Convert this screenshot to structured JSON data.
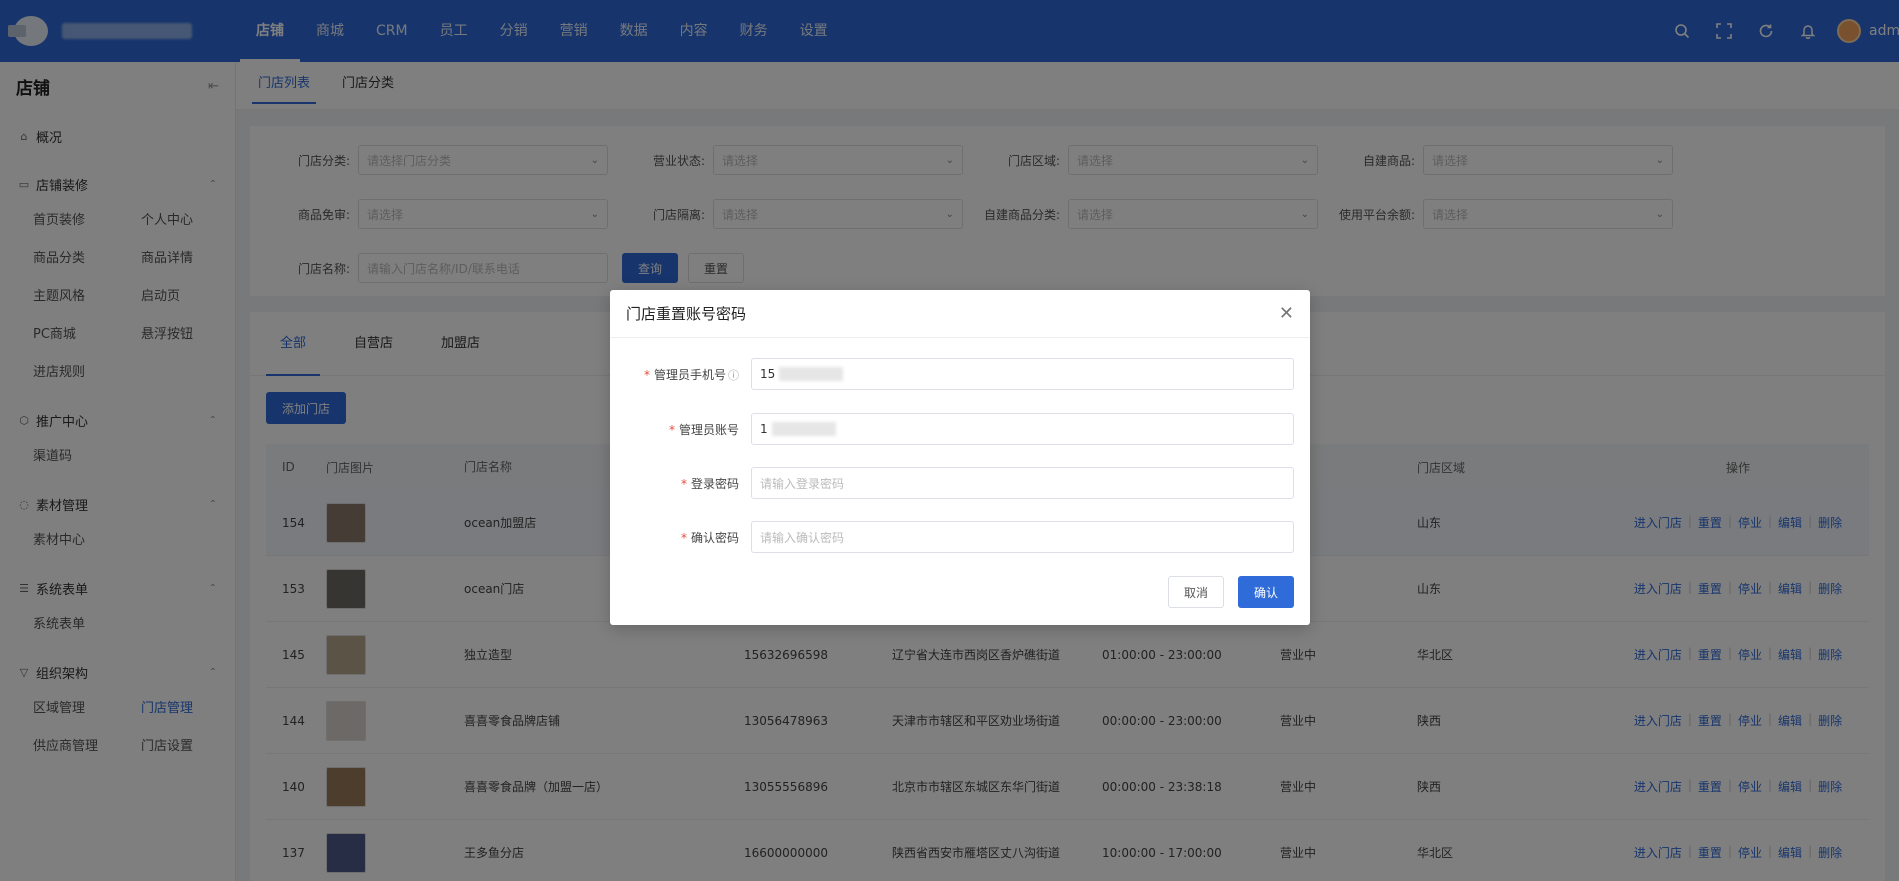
{
  "top_nav": {
    "items": [
      "店铺",
      "商城",
      "CRM",
      "员工",
      "分销",
      "营销",
      "数据",
      "内容",
      "财务",
      "设置"
    ],
    "active_index": 0,
    "user_name": "admin"
  },
  "icons": {
    "search": "search-icon",
    "fullscreen": "fullscreen-icon",
    "refresh": "refresh-icon",
    "bell": "bell-icon"
  },
  "sidebar": {
    "title": "店铺",
    "overview": "概况",
    "groups": [
      {
        "label": "店铺装修",
        "items": [
          "首页装修",
          "个人中心",
          "商品分类",
          "商品详情",
          "主题风格",
          "启动页",
          "PC商城",
          "悬浮按钮",
          "进店规则"
        ]
      },
      {
        "label": "推广中心",
        "items": [
          "渠道码"
        ]
      },
      {
        "label": "素材管理",
        "items": [
          "素材中心"
        ]
      },
      {
        "label": "系统表单",
        "items": [
          "系统表单"
        ]
      },
      {
        "label": "组织架构",
        "items": [
          "区域管理",
          "门店管理",
          "供应商管理",
          "门店设置"
        ]
      }
    ],
    "active_item": "门店管理"
  },
  "page_tabs": [
    "门店列表",
    "门店分类"
  ],
  "filters": {
    "store_category": {
      "label": "门店分类:",
      "placeholder": "请选择门店分类"
    },
    "business_status": {
      "label": "营业状态:",
      "placeholder": "请选择"
    },
    "store_region": {
      "label": "门店区域:",
      "placeholder": "请选择"
    },
    "self_goods": {
      "label": "自建商品:",
      "placeholder": "请选择"
    },
    "goods_review": {
      "label": "商品免审:",
      "placeholder": "请选择"
    },
    "store_hidden": {
      "label": "门店隔离:",
      "placeholder": "请选择"
    },
    "self_goods_category": {
      "label": "自建商品分类:",
      "placeholder": "请选择"
    },
    "platform_balance": {
      "label": "使用平台余额:",
      "placeholder": "请选择"
    },
    "store_name": {
      "label": "门店名称:",
      "placeholder": "请输入门店名称/ID/联系电话"
    },
    "query_label": "查询",
    "reset_label": "重置"
  },
  "list_tabs": [
    "全部",
    "自营店",
    "加盟店"
  ],
  "add_store_label": "添加门店",
  "table": {
    "headers": {
      "id": "ID",
      "image": "门店图片",
      "name": "门店名称",
      "region": "门店区域",
      "ops": "操作"
    },
    "rows": [
      {
        "id": "154",
        "name": "ocean加盟店",
        "phone": "",
        "address": "",
        "hours": "",
        "status": "中",
        "region": "山东",
        "thumb_color": "#8a7a6a"
      },
      {
        "id": "153",
        "name": "ocean门店",
        "phone": "",
        "address": "",
        "hours": "",
        "status": "中",
        "region": "山东",
        "thumb_color": "#6d6a63"
      },
      {
        "id": "145",
        "name": "独立造型",
        "phone": "15632696598",
        "address": "辽宁省大连市西岗区香炉礁街道",
        "hours": "01:00:00 - 23:00:00",
        "status": "营业中",
        "region": "华北区",
        "thumb_color": "#b9a78e"
      },
      {
        "id": "144",
        "name": "喜喜零食品牌店铺",
        "phone": "13056478963",
        "address": "天津市市辖区和平区劝业场街道",
        "hours": "00:00:00 - 23:00:00",
        "status": "营业中",
        "region": "陕西",
        "thumb_color": "#d8d3cc"
      },
      {
        "id": "140",
        "name": "喜喜零食品牌（加盟一店）",
        "phone": "13055556896",
        "address": "北京市市辖区东城区东华门街道",
        "hours": "00:00:00 - 23:38:18",
        "status": "营业中",
        "region": "陕西",
        "thumb_color": "#9a7b58"
      },
      {
        "id": "137",
        "name": "王多鱼分店",
        "phone": "16600000000",
        "address": "陕西省西安市雁塔区丈八沟街道",
        "hours": "10:00:00 - 17:00:00",
        "status": "营业中",
        "region": "华北区",
        "thumb_color": "#4f5a8a"
      }
    ],
    "ops": [
      "进入门店",
      "重置",
      "停业",
      "编辑",
      "删除"
    ]
  },
  "modal": {
    "title": "门店重置账号密码",
    "fields": {
      "phone": {
        "label": "管理员手机号",
        "value": "15"
      },
      "account": {
        "label": "管理员账号",
        "value": "1"
      },
      "password": {
        "label": "登录密码",
        "placeholder": "请输入登录密码"
      },
      "confirm": {
        "label": "确认密码",
        "placeholder": "请输入确认密码"
      }
    },
    "cancel_label": "取消",
    "confirm_label": "确认"
  },
  "colors": {
    "primary": "#2f6bd9"
  }
}
